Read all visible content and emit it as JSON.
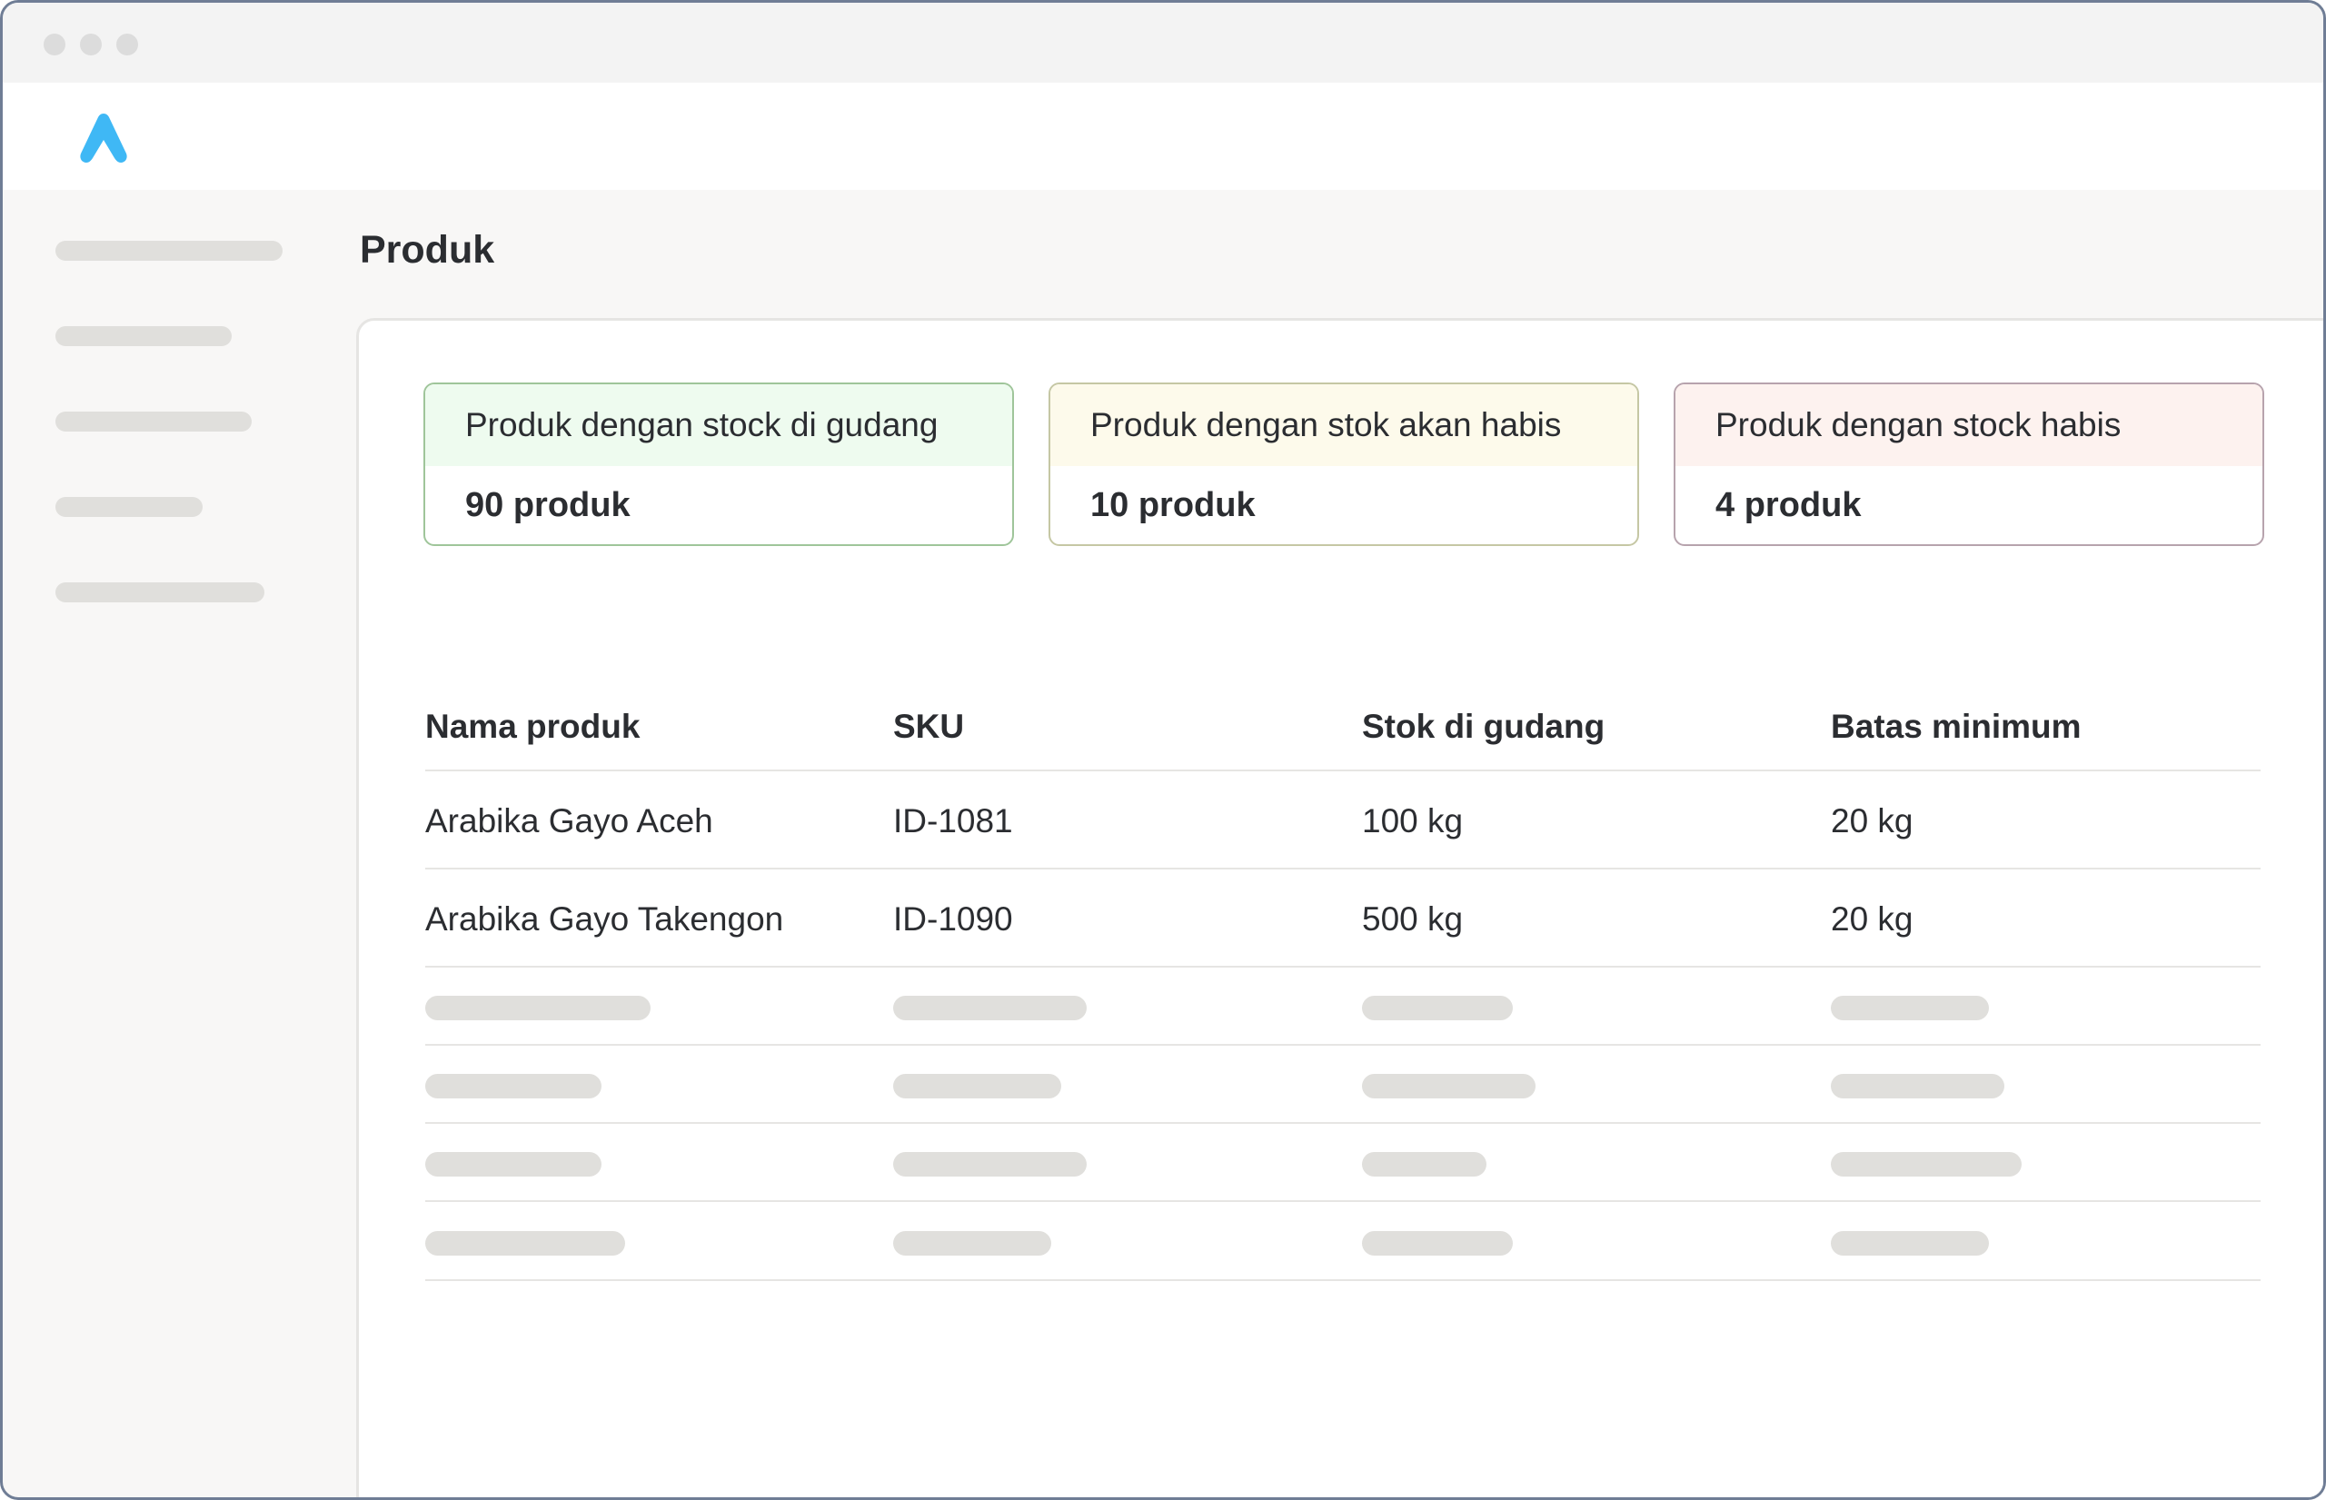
{
  "window": {
    "controls": [
      "close-dot",
      "minimize-dot",
      "maximize-dot"
    ]
  },
  "brand": {
    "logo_icon": "app-logo-icon",
    "accent_color": "#3fb8f5"
  },
  "page": {
    "title": "Produk"
  },
  "summary_cards": [
    {
      "label": "Produk dengan stock di gudang",
      "value": "90 produk",
      "status_color": "#9fc59a"
    },
    {
      "label": "Produk dengan stok akan habis",
      "value": "10 produk",
      "status_color": "#c5c7a4"
    },
    {
      "label": "Produk dengan stock habis",
      "value": "4 produk",
      "status_color": "#b7a3ad"
    }
  ],
  "table": {
    "headers": [
      "Nama produk",
      "SKU",
      "Stok di gudang",
      "Batas minimum"
    ],
    "rows": [
      [
        "Arabika Gayo Aceh",
        "ID-1081",
        "100 kg",
        "20 kg"
      ],
      [
        "Arabika Gayo Takengon",
        "ID-1090",
        "500 kg",
        "20 kg"
      ]
    ]
  }
}
